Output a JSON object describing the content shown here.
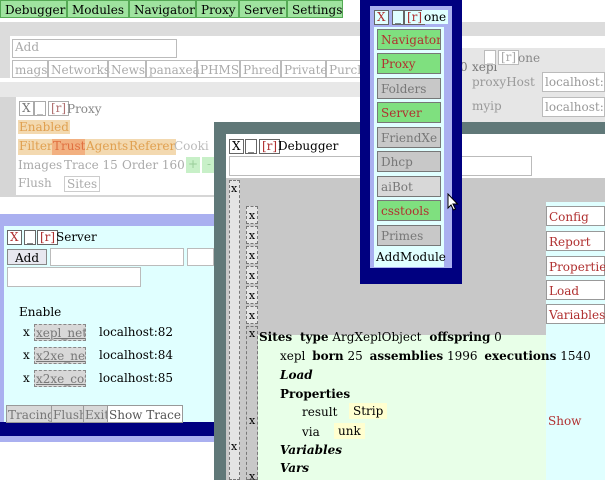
{
  "top_menu": [
    "Debugger",
    "Modules",
    "Navigator",
    "Proxy",
    "Server",
    "Settings"
  ],
  "modules_window": {
    "add_label": "Add",
    "tabs": [
      "mags",
      "Networks",
      "News",
      "panaxea",
      "PHMS",
      "Phred",
      "Private",
      "Purch"
    ]
  },
  "proxy_window": {
    "close": "X",
    "min": "_",
    "restore": "[r]",
    "title": "Proxy",
    "enabled": "Enabled",
    "tabs": [
      "Filter",
      "Trust",
      "Agents",
      "Referer",
      "Cooki"
    ],
    "row3": [
      "Images",
      "Trace 15",
      "Order 160",
      "+",
      "-"
    ],
    "row4": [
      "Flush",
      "Sites"
    ]
  },
  "settings_window": {
    "zero": "0",
    "xepl": "xepl",
    "min": "_",
    "restore": "[r]",
    "one": "one",
    "proxyhost_label": "proxyHost",
    "proxyhost_value": "localhost:8",
    "myip_label": "myip",
    "myip_value": "localhost:8"
  },
  "navigator_window": {
    "close": "X",
    "min": "_",
    "restore": "[r]",
    "title": "one",
    "buttons": [
      {
        "label": "Navigator",
        "active": true
      },
      {
        "label": "Proxy",
        "active": true
      },
      {
        "label": "Folders",
        "active": false
      },
      {
        "label": "Server",
        "active": true
      },
      {
        "label": "FriendXe",
        "active": false
      },
      {
        "label": "Dhcp",
        "active": false
      },
      {
        "label": "aiBot",
        "active": false
      },
      {
        "label": "csstools",
        "active": true
      },
      {
        "label": "Primes",
        "active": false
      }
    ],
    "add_module": "AddModule"
  },
  "server_window": {
    "close": "X",
    "min": "_",
    "restore": "[r]",
    "title": "Server",
    "add": "Add",
    "enable": "Enable",
    "rows": [
      {
        "x": "x",
        "name": "xepl_net",
        "host": "localhost:82"
      },
      {
        "x": "x",
        "name": "x2xe_net",
        "host": "localhost:84"
      },
      {
        "x": "x",
        "name": "x2xe_com",
        "host": "localhost:85"
      }
    ],
    "tabs": [
      "Tracing",
      "Flush",
      "Exit",
      "Show Trace"
    ]
  },
  "debugger_window": {
    "close": "X",
    "min": "_",
    "restore": "[r]",
    "title": "Debugger",
    "x_marks": [
      "x",
      "x",
      "x",
      "x",
      "x",
      "x",
      "x",
      "x",
      "x",
      "x",
      "x"
    ],
    "side_buttons": [
      "Config",
      "Report",
      "Properties",
      "Load",
      "Variables"
    ],
    "show": "Show",
    "tree": {
      "sites": "Sites",
      "type_key": "type",
      "type_val": "ArgXeplObject",
      "offspring_key": "offspring",
      "offspring_val": "0",
      "xepl": "xepl",
      "born_key": "born",
      "born_val": "25",
      "assemblies_key": "assemblies",
      "assemblies_val": "1996",
      "executions_key": "executions",
      "executions_val": "1540",
      "load": "Load",
      "properties": "Properties",
      "result_key": "result",
      "result_val": "Strip",
      "via_key": "via",
      "via_val": "unk",
      "variables": "Variables",
      "vars": "Vars"
    }
  },
  "colors": {
    "green": "#7fe07f",
    "navy": "#000080",
    "periwinkle": "#aab0f0",
    "light_cyan": "#e0ffff",
    "gray": "#c8c8c8",
    "red_text": "#b03030"
  }
}
